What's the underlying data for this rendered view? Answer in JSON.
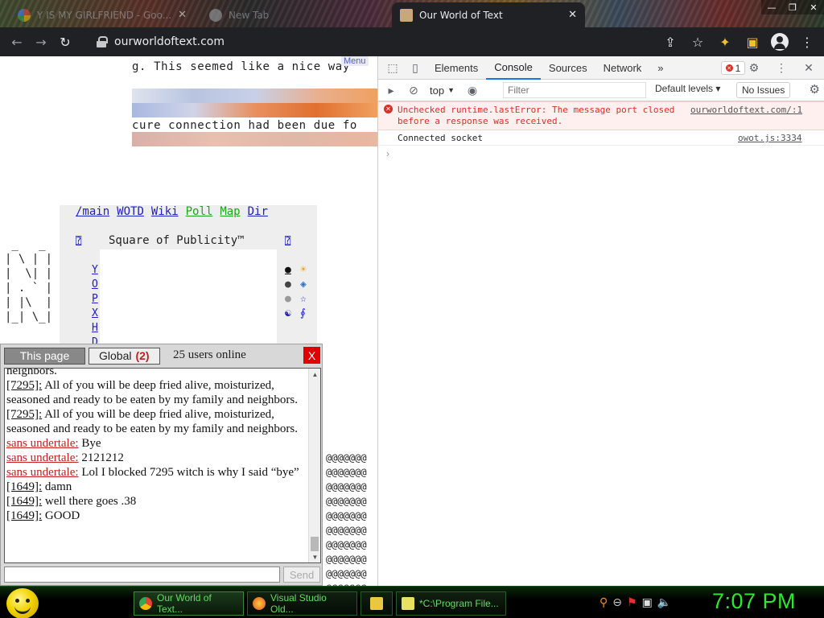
{
  "browser": {
    "tabs": [
      {
        "label": "Y IS MY GIRLFRIEND - Goo...",
        "active": false
      },
      {
        "label": "New Tab",
        "active": false
      },
      {
        "label": "Our World of Text",
        "active": true
      }
    ],
    "url": "ourworldoftext.com"
  },
  "page": {
    "line1": "g. This seemed like a nice way",
    "line2": "cure connection had been due fo",
    "menu_tag": "Menu",
    "nav_links": [
      "/main",
      "WOTD",
      "Wiki",
      "Poll",
      "Map",
      "Dir"
    ],
    "square_title": "Square of Publicity™",
    "square_left_mark": "⍰",
    "square_right_mark": "⍰",
    "yo_letters": [
      "Y",
      "O",
      "P",
      "X",
      "H",
      "D"
    ],
    "symbols_left": [
      "●",
      "●",
      "●",
      "☯"
    ],
    "symbols_right": [
      "☀",
      "◈",
      "☆",
      "∮"
    ],
    "ascii_n": " _   _\n| \\ | |\n|  \\| |\n| . ` |\n| |\\  |\n|_| \\_|",
    "at_grid": "@@@@@@@\n@@@@@@@\n@@@@@@@\n@@@@@@@\n@@@@@@@\n@@@@@@@\n@@@@@@@\n@@@@@@@\n@@@@@@@\n@@@@@@@\n@@@@@@@\n@@@@@@@\n@@@@@@@"
  },
  "chat": {
    "tab_page": "This page",
    "tab_global": "Global",
    "global_count": "(2)",
    "users_online": "25 users online",
    "close": "X",
    "send": "Send",
    "input_value": "",
    "messages": [
      {
        "nick": "",
        "text": "neighbors.",
        "red": false
      },
      {
        "nick": "[7295]:",
        "text": " All of you will be deep fried alive, moisturized, seasoned and ready to be eaten by my family and neighbors.",
        "red": false
      },
      {
        "nick": "[7295]:",
        "text": " All of you will be deep fried alive, moisturized, seasoned and ready to be eaten by my family and neighbors.",
        "red": false
      },
      {
        "nick": "sans undertale:",
        "text": " Bye",
        "red": true
      },
      {
        "nick": "sans undertale:",
        "text": " 2121212",
        "red": true
      },
      {
        "nick": "sans undertale:",
        "text": " Lol I blocked 7295 witch is why I said “bye”",
        "red": true
      },
      {
        "nick": "[1649]:",
        "text": " damn",
        "red": false
      },
      {
        "nick": "[1649]:",
        "text": " well there goes .38",
        "red": false
      },
      {
        "nick": "[1649]:",
        "text": " GOOD",
        "red": false
      }
    ]
  },
  "devtools": {
    "tabs": [
      "Elements",
      "Console",
      "Sources",
      "Network"
    ],
    "more": "»",
    "error_count": "1",
    "context": "top",
    "filter_placeholder": "Filter",
    "levels": "Default levels ▾",
    "no_issues": "No Issues",
    "error_message": "Unchecked runtime.lastError: The message port closed before a response was received.",
    "error_source": "ourworldoftext.com/:1",
    "log_message": "Connected socket",
    "log_source": "owot.js:3334",
    "prompt": "›"
  },
  "taskbar": {
    "tasks": [
      {
        "label": "Our World of Text...",
        "active": true
      },
      {
        "label": "Visual Studio Old...",
        "active": false
      },
      {
        "label": "",
        "active": false
      },
      {
        "label": "*C:\\Program File...",
        "active": false
      }
    ],
    "clock": "7:07 PM"
  },
  "colors": {
    "accent_blue": "#1a73e8",
    "error_red": "#d93025",
    "taskbar_green": "#2ee82e",
    "chat_red": "#c02020"
  }
}
